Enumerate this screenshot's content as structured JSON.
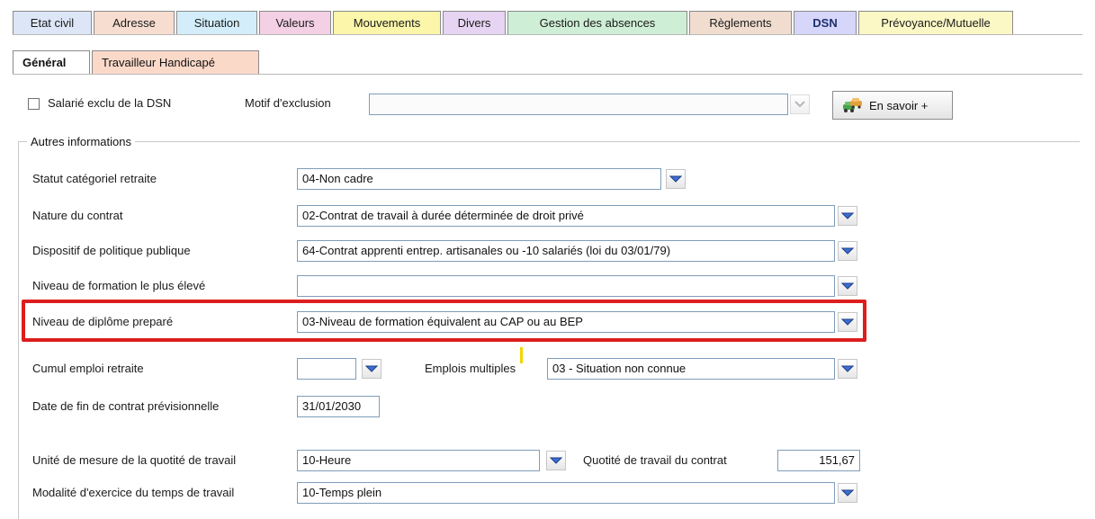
{
  "colors": {
    "tab_etat_civil": "#dce6f7",
    "tab_adresse": "#f7ddd0",
    "tab_situation": "#d3eefa",
    "tab_valeurs": "#f3d0e4",
    "tab_mouvements": "#fbf6a9",
    "tab_divers": "#e6d4f2",
    "tab_gestion": "#cfeed6",
    "tab_reglements": "#f0ddcf",
    "tab_dsn": "#d6d6fb",
    "tab_prevoyance": "#fbf8c6",
    "subtab_handicap": "#fbd9c9",
    "highlight": "#dd1e1e"
  },
  "tabs": [
    {
      "label": "Etat civil"
    },
    {
      "label": "Adresse"
    },
    {
      "label": "Situation"
    },
    {
      "label": "Valeurs"
    },
    {
      "label": "Mouvements"
    },
    {
      "label": "Divers"
    },
    {
      "label": "Gestion des absences"
    },
    {
      "label": "Règlements"
    },
    {
      "label": "DSN"
    },
    {
      "label": "Prévoyance/Mutuelle"
    }
  ],
  "subtabs": [
    {
      "label": "Général"
    },
    {
      "label": "Travailleur Handicapé"
    }
  ],
  "exclusion": {
    "checkbox_label": "Salarié exclu de la DSN",
    "checked": false,
    "motif_label": "Motif d'exclusion",
    "motif_value": "",
    "info_button": "En savoir +",
    "info_icon": "cars-icon"
  },
  "group": {
    "legend": "Autres informations",
    "statut": {
      "label": "Statut catégoriel retraite",
      "value": "04-Non cadre"
    },
    "nature": {
      "label": "Nature du contrat",
      "value": "02-Contrat de travail à durée déterminée de droit privé"
    },
    "dispositif": {
      "label": "Dispositif de politique publique",
      "value": "64-Contrat apprenti entrep. artisanales ou -10 salariés (loi du 03/01/79)"
    },
    "niveau_formation": {
      "label": "Niveau de formation le plus élevé",
      "value": ""
    },
    "niveau_diplome": {
      "label": "Niveau de diplôme preparé",
      "value": "03-Niveau de formation équivalent au CAP ou au BEP"
    },
    "cumul": {
      "label": "Cumul emploi retraite",
      "value": ""
    },
    "emplois": {
      "label": "Emplois multiples",
      "value": "03 - Situation non connue"
    },
    "date_fin": {
      "label": "Date de fin de contrat prévisionnelle",
      "value": "31/01/2030"
    },
    "unite": {
      "label": "Unité de mesure de la quotité de travail",
      "value": "10-Heure"
    },
    "quotite": {
      "label": "Quotité de travail du contrat",
      "value": "151,67"
    },
    "modalite": {
      "label": "Modalité d'exercice du temps de travail",
      "value": "10-Temps plein"
    }
  }
}
